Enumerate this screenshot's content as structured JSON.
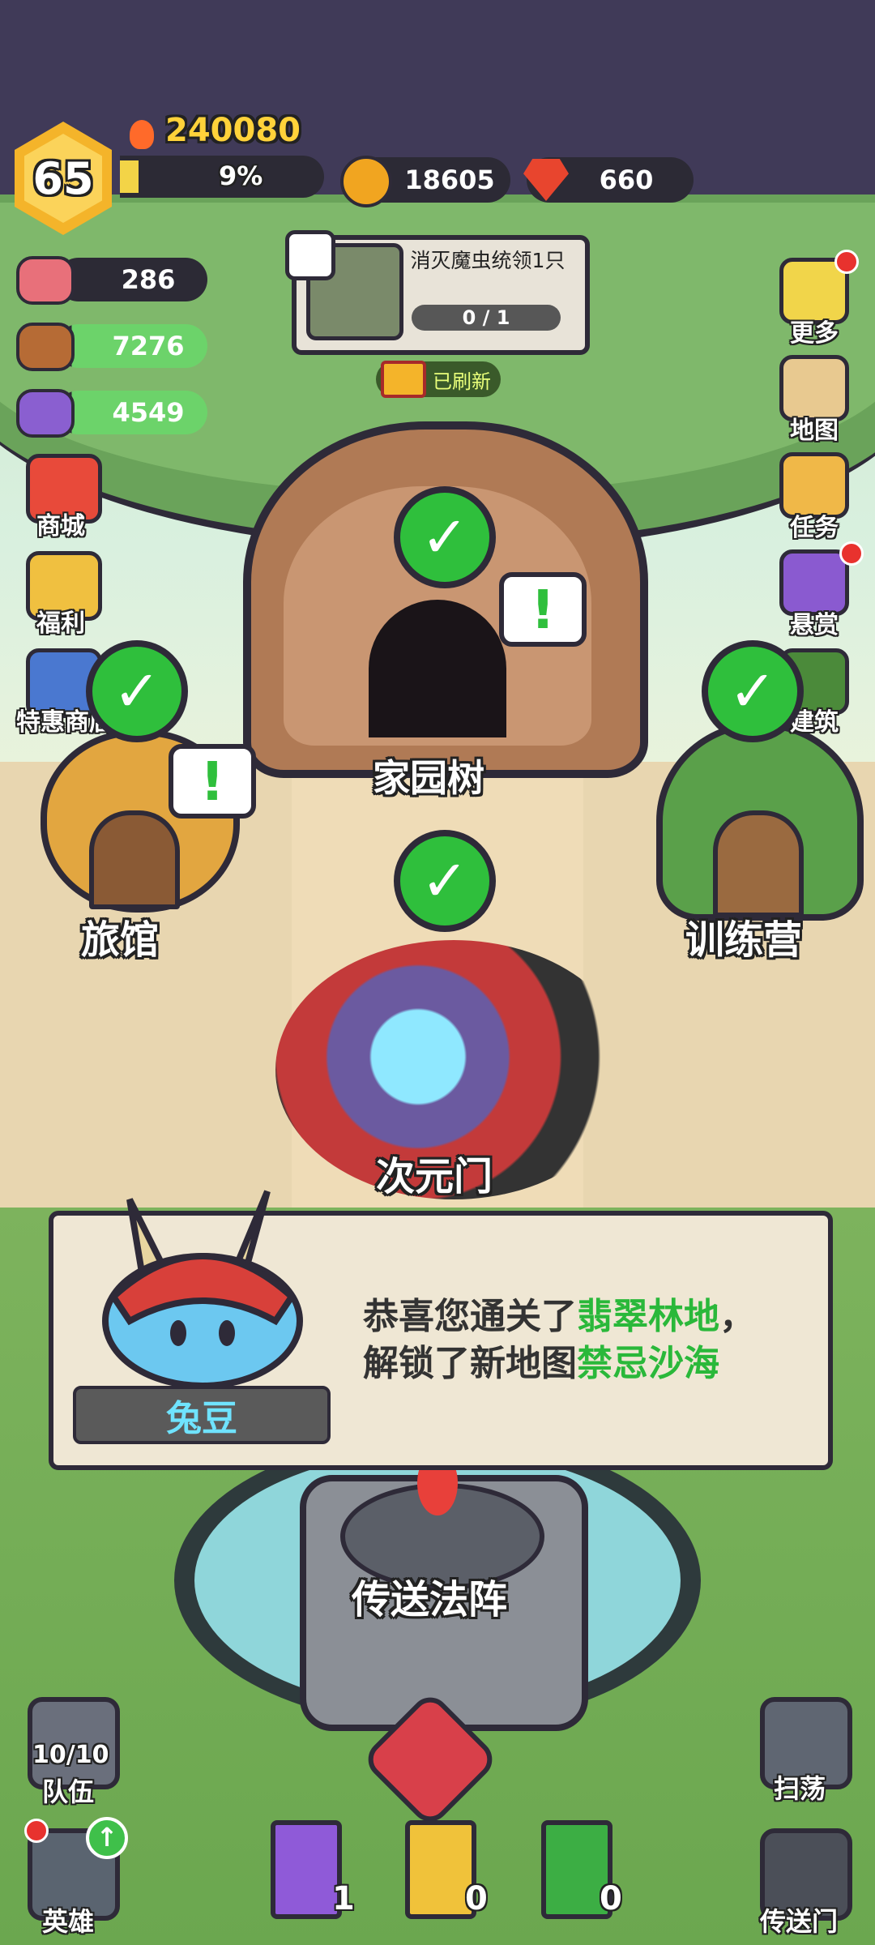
{
  "player": {
    "level": "65",
    "power": "240080",
    "xp_percent_label": "9%",
    "xp_fraction": 0.09,
    "coins": "18605",
    "gems": "660"
  },
  "resources": [
    {
      "icon": "meat-icon",
      "value": "286"
    },
    {
      "icon": "wood-icon",
      "value": "7276"
    },
    {
      "icon": "ingot-icon",
      "value": "4549"
    }
  ],
  "quest": {
    "title": "消灭魔虫统领1只",
    "progress": "0 / 1",
    "refresh_label": "已刷新"
  },
  "left_menu": {
    "shop": "商城",
    "welfare": "福利",
    "special_shop": "特惠商店"
  },
  "right_menu": {
    "more": "更多",
    "map": "地图",
    "tasks": "任务",
    "bounty": "悬赏",
    "build": "建筑"
  },
  "buildings": {
    "home_tree": "家园树",
    "inn": "旅馆",
    "training": "训练营",
    "dimension_gate": "次元门",
    "teleport_array": "传送法阵"
  },
  "dialog": {
    "speaker": "兔豆",
    "line1_prefix": "恭喜您通关了",
    "line1_highlight": "翡翠林地",
    "line1_suffix": "，",
    "line2_prefix": "解锁了新地图",
    "line2_highlight": "禁忌沙海"
  },
  "bottom": {
    "team_count": "10/10",
    "team_label": "队伍",
    "hero_label": "英雄",
    "sweep_label": "扫荡",
    "portal_label": "传送门",
    "books": [
      {
        "icon": "purple-lightning-book-icon",
        "count": "1"
      },
      {
        "icon": "gold-book-icon",
        "count": "0"
      },
      {
        "icon": "green-cross-book-icon",
        "count": "0"
      }
    ]
  },
  "colors": {
    "accent_green": "#2ab83a",
    "gold": "#f4b42a",
    "dark_outline": "#2e2a38"
  }
}
